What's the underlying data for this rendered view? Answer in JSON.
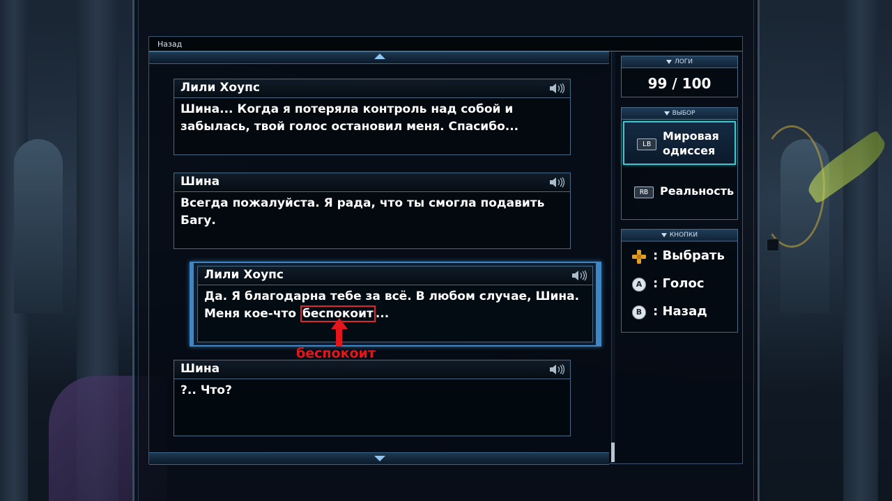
{
  "header": {
    "back_title": "Назад"
  },
  "messages": [
    {
      "speaker": "Лили Хоупс",
      "line1": "Шина... Когда я потеряла контроль над собой и",
      "line2": "забылась, твой голос остановил меня. Спасибо..."
    },
    {
      "speaker": "Шина",
      "line1": "Всегда пожалуйста. Я рада, что ты смогла подавить",
      "line2": "Багу."
    },
    {
      "speaker": "Лили Хоупс",
      "line1": "Да. Я благодарна тебе за всё. В любом случае, Шина.",
      "line2_pre": "Меня кое-что ",
      "line2_highlight": "беспокоит",
      "line2_post": "..."
    },
    {
      "speaker": "Шина",
      "line1": "?.. Что?",
      "line2": ""
    }
  ],
  "annotation": {
    "label": "беспокоит",
    "color": "#e4161b"
  },
  "logs": {
    "title": "ЛОГИ",
    "value": "99 / 100"
  },
  "choices": {
    "title": "ВЫБОР",
    "items": [
      {
        "button": "LB",
        "label_line1": "Мировая",
        "label_line2": "одиссея",
        "active": true
      },
      {
        "button": "RB",
        "label_line1": "Реальность",
        "active": false
      }
    ]
  },
  "controls": {
    "title": "КНОПКИ",
    "items": [
      {
        "icon": "dpad-icon",
        "label": ": Выбрать"
      },
      {
        "icon": "a-button-icon",
        "button": "A",
        "label": ": Голос"
      },
      {
        "icon": "b-button-icon",
        "button": "B",
        "label": ": Назад"
      }
    ]
  },
  "colors": {
    "accent": "#3f87c4",
    "active_choice": "#3fc6cf",
    "annotation": "#e4161b"
  }
}
